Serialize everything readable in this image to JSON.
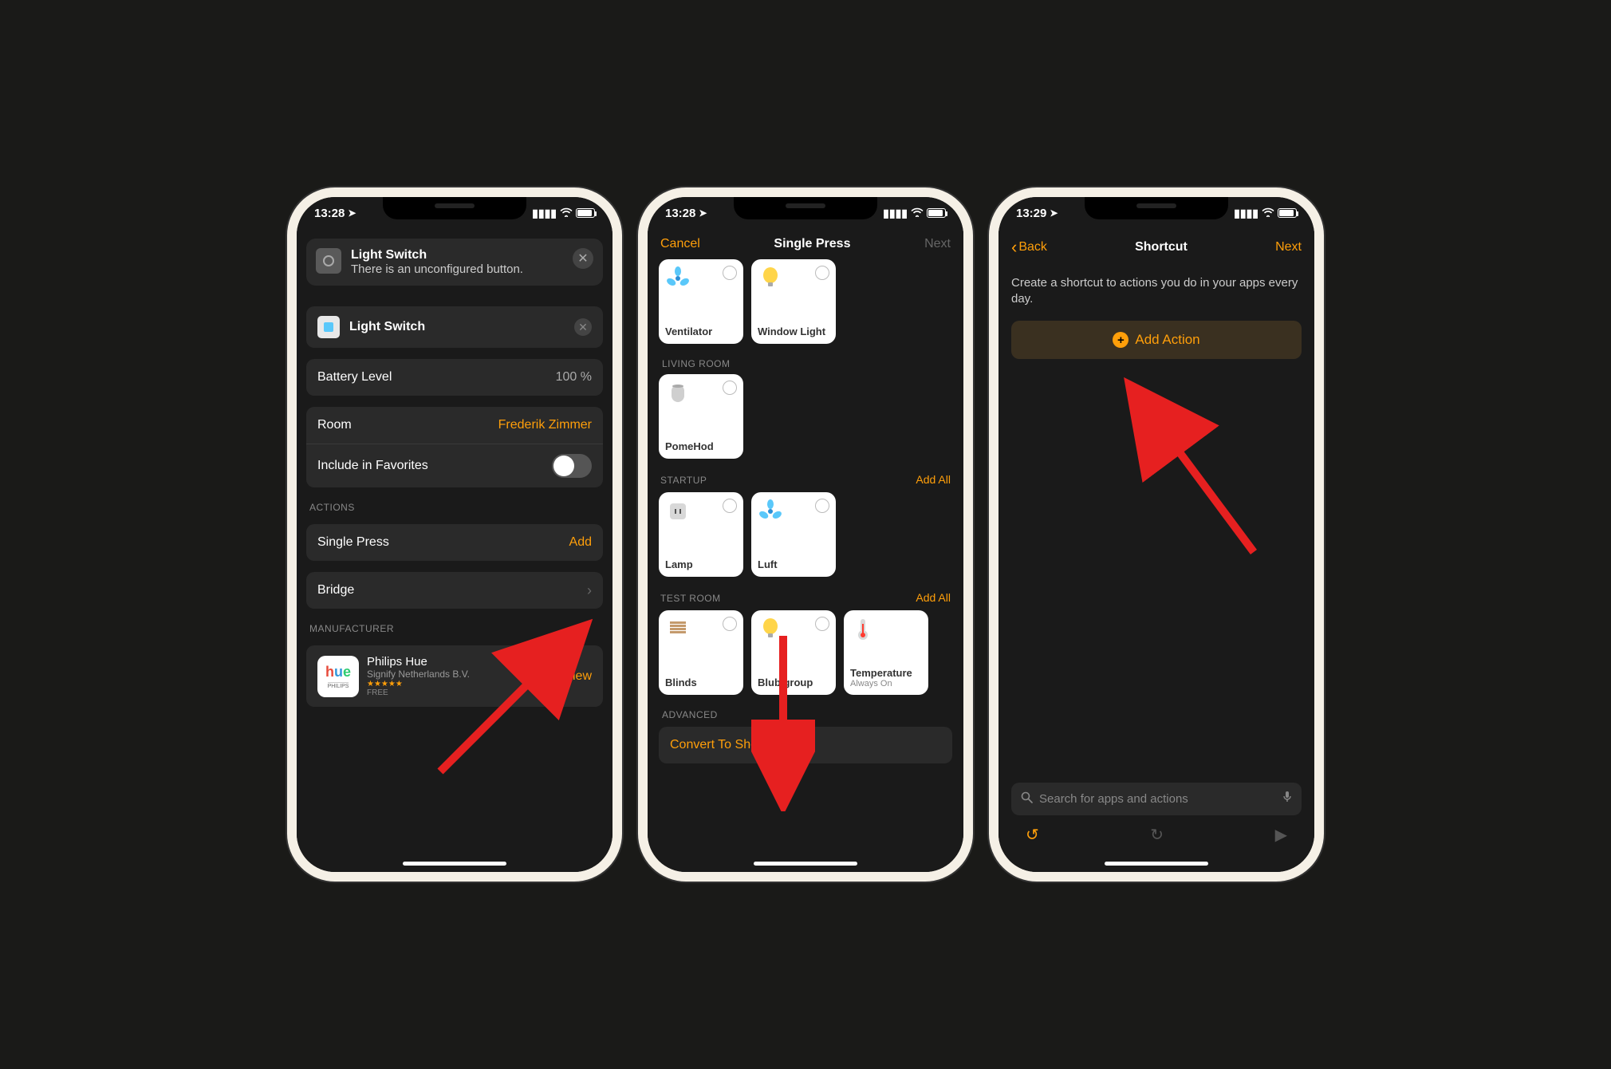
{
  "screen1": {
    "status_time": "13:28",
    "banner": {
      "title": "Light Switch",
      "subtitle": "There is an unconfigured button."
    },
    "name_row": {
      "label": "Light Switch"
    },
    "battery": {
      "label": "Battery Level",
      "value": "100 %"
    },
    "room": {
      "label": "Room",
      "value": "Frederik Zimmer"
    },
    "favorites": {
      "label": "Include in Favorites"
    },
    "actions_header": "ACTIONS",
    "single_press": {
      "label": "Single Press",
      "value": "Add"
    },
    "bridge": {
      "label": "Bridge"
    },
    "manufacturer_header": "MANUFACTURER",
    "manufacturer": {
      "name": "Philips Hue",
      "company": "Signify Netherlands B.V.",
      "free": "FREE",
      "view": "View"
    }
  },
  "screen2": {
    "status_time": "13:28",
    "nav": {
      "cancel": "Cancel",
      "title": "Single Press",
      "next": "Next"
    },
    "tiles_top": [
      {
        "label": "Ventilator",
        "icon": "fan"
      },
      {
        "label": "Window Light",
        "icon": "bulb"
      }
    ],
    "living_room_header": "LIVING ROOM",
    "living_room_tile": {
      "label": "PomeHod",
      "icon": "homepod"
    },
    "startup_header": "STARTUP",
    "startup_add_all": "Add All",
    "startup_tiles": [
      {
        "label": "Lamp",
        "icon": "plug"
      },
      {
        "label": "Luft",
        "icon": "fan"
      }
    ],
    "test_room_header": "TEST ROOM",
    "test_room_add_all": "Add All",
    "test_room_tiles": [
      {
        "label": "Blinds",
        "icon": "blinds"
      },
      {
        "label": "Blub group",
        "icon": "bulb"
      },
      {
        "label": "Temperature",
        "sub": "Always On",
        "icon": "thermo"
      }
    ],
    "advanced_header": "ADVANCED",
    "convert": "Convert To Shortcut"
  },
  "screen3": {
    "status_time": "13:29",
    "nav": {
      "back": "Back",
      "title": "Shortcut",
      "next": "Next"
    },
    "description": "Create a shortcut to actions you do in your apps every day.",
    "add_action": "Add Action",
    "search_placeholder": "Search for apps and actions"
  }
}
